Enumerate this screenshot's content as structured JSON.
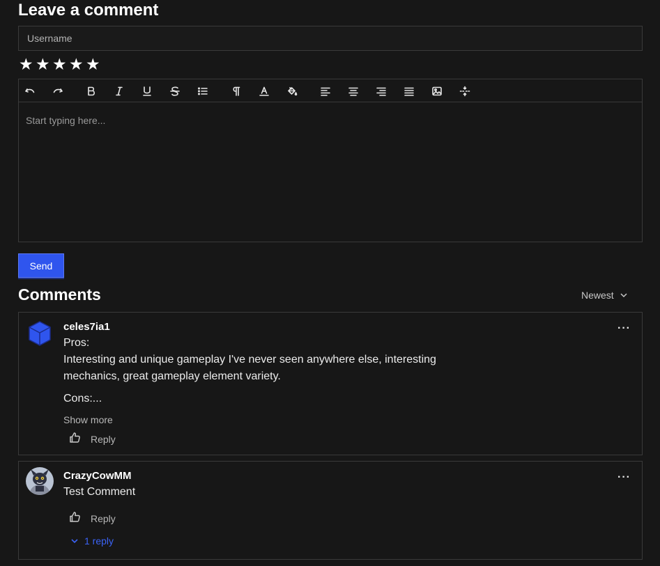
{
  "form": {
    "title": "Leave a comment",
    "username_placeholder": "Username",
    "rating_stars": 5,
    "editor_placeholder": "Start typing here...",
    "send_label": "Send",
    "toolbar_icons": [
      "undo-icon",
      "redo-icon",
      "bold-icon",
      "italic-icon",
      "underline-icon",
      "strikethrough-icon",
      "bullet-list-icon",
      "paragraph-icon",
      "text-color-icon",
      "fill-color-icon",
      "align-left-icon",
      "align-center-icon",
      "align-right-icon",
      "align-justify-icon",
      "image-icon",
      "horizontal-rule-icon"
    ]
  },
  "comments_section": {
    "title": "Comments",
    "sort_label": "Newest",
    "comments": [
      {
        "username": "celes7ia1",
        "avatar": "blue-cube-avatar",
        "lines": [
          "Pros:",
          "Interesting and unique gameplay I've never seen anywhere else, interesting mechanics, great gameplay element variety.",
          "Cons:..."
        ],
        "show_more": "Show more",
        "reply_label": "Reply"
      },
      {
        "username": "CrazyCowMM",
        "avatar": "cartoon-character-avatar",
        "lines": [
          "Test Comment"
        ],
        "reply_label": "Reply",
        "replies_label": "1 reply"
      }
    ]
  },
  "colors": {
    "background": "#171717",
    "accent": "#2f55ee",
    "link": "#3b63f5",
    "border": "#3a3a3a"
  }
}
